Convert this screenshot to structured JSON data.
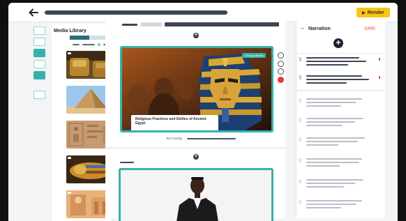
{
  "header": {
    "back_icon": "arrow-left-icon",
    "render_label": "Render",
    "render_icon": "play-icon",
    "accent": "#35b2ab",
    "render_color": "#f5c518"
  },
  "media_library": {
    "title": "Media Library",
    "collapse_icon": "arrow-left-icon",
    "items": [
      {
        "subject": "sarcophagi in tomb",
        "type": "video"
      },
      {
        "subject": "pyramid of giza",
        "type": "image"
      },
      {
        "subject": "hieroglyph wall",
        "type": "image"
      },
      {
        "subject": "golden mummy case",
        "type": "video"
      },
      {
        "subject": "temple column",
        "type": "image"
      }
    ]
  },
  "canvas": {
    "scene1": {
      "badge": "Change Media",
      "caption": "Religious Practices and Deities of Ancient Egypt"
    },
    "text_overlay_label": "Text Overlay"
  },
  "narration": {
    "title": "Narration",
    "badge": "● 0:00",
    "add_icon": "plus-icon"
  }
}
